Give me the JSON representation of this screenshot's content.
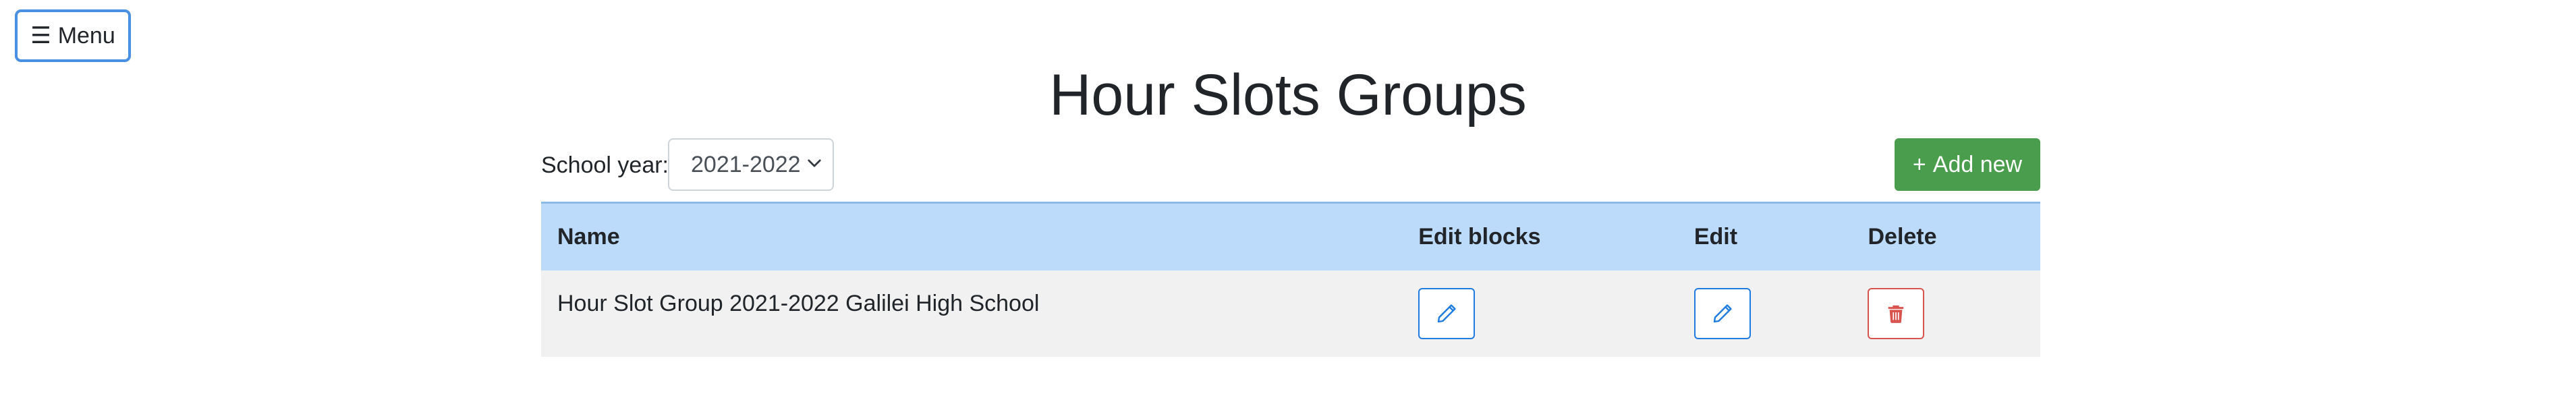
{
  "menu": {
    "icon": "hamburger-icon",
    "label": "Menu"
  },
  "page": {
    "title": "Hour Slots Groups"
  },
  "toolbar": {
    "school_year_label": "School year:",
    "school_year_value": "2021-2022",
    "add_label": "Add new",
    "add_icon": "plus-icon"
  },
  "table": {
    "headers": {
      "name": "Name",
      "edit_blocks": "Edit blocks",
      "edit": "Edit",
      "delete": "Delete"
    },
    "rows": [
      {
        "name": "Hour Slot Group 2021-2022 Galilei High School",
        "edit_blocks_icon": "pencil-icon",
        "edit_icon": "pencil-icon",
        "delete_icon": "trash-icon"
      }
    ]
  },
  "colors": {
    "menu_border": "#4a90e2",
    "header_bg": "#bcdafa",
    "row_bg": "#f1f1f1",
    "add_button": "#4a9d4c",
    "edit_accent": "#1e7be0",
    "delete_accent": "#d9534f"
  }
}
